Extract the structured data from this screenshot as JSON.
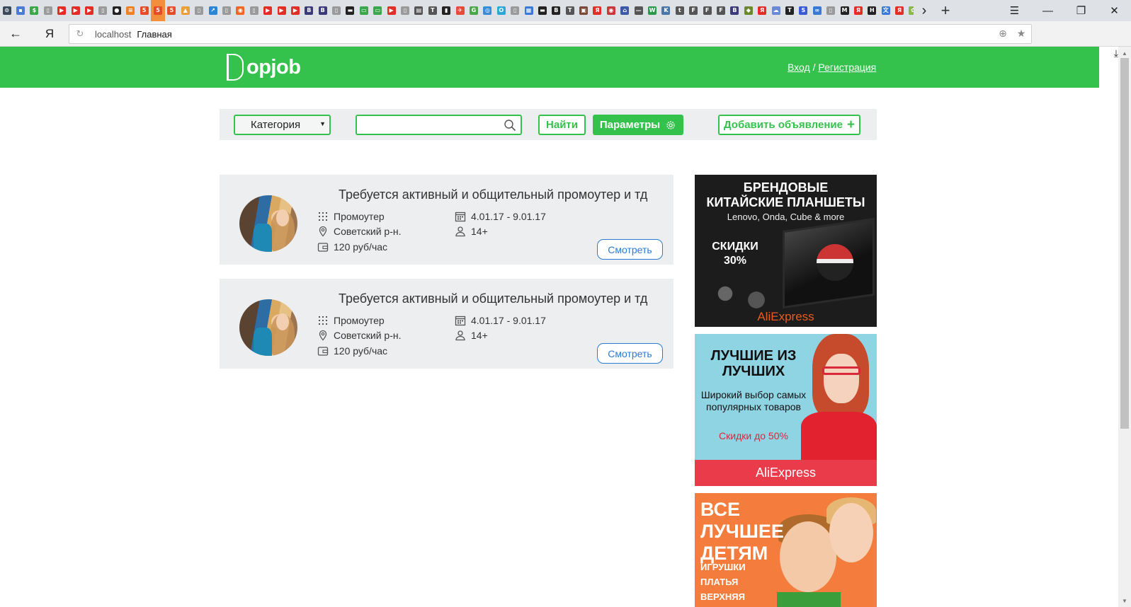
{
  "browser": {
    "tab_favicons": [
      {
        "icon": "opera-icon",
        "color": "#3b4a5a",
        "glyph": "⊙"
      },
      {
        "icon": "chart-icon",
        "color": "#4a7bd6",
        "glyph": "▪"
      },
      {
        "icon": "dollar-icon",
        "color": "#3aa84a",
        "glyph": "$"
      },
      {
        "icon": "page-icon",
        "color": "#9a9a9a",
        "glyph": "▯"
      },
      {
        "icon": "youtube-icon",
        "color": "#e52d27",
        "glyph": "▶"
      },
      {
        "icon": "youtube-icon",
        "color": "#e52d27",
        "glyph": "▶"
      },
      {
        "icon": "youtube-icon",
        "color": "#e52d27",
        "glyph": "▶"
      },
      {
        "icon": "page-icon",
        "color": "#9a9a9a",
        "glyph": "▯"
      },
      {
        "icon": "github-icon",
        "color": "#222222",
        "glyph": "●"
      },
      {
        "icon": "stackoverflow-icon",
        "color": "#f48024",
        "glyph": "≡"
      },
      {
        "icon": "html-icon",
        "color": "#e44d26",
        "glyph": "5"
      },
      {
        "icon": "html-icon",
        "color": "#e44d26",
        "glyph": "5"
      },
      {
        "icon": "html-icon",
        "color": "#e44d26",
        "glyph": "5"
      },
      {
        "icon": "image-icon",
        "color": "#e8a13a",
        "glyph": "▲"
      },
      {
        "icon": "page-icon",
        "color": "#9a9a9a",
        "glyph": "▯"
      },
      {
        "icon": "chart-icon",
        "color": "#2a85d6",
        "glyph": "↗"
      },
      {
        "icon": "page-icon",
        "color": "#9a9a9a",
        "glyph": "▯"
      },
      {
        "icon": "orange-icon",
        "color": "#f26522",
        "glyph": "◉"
      },
      {
        "icon": "page-icon",
        "color": "#9a9a9a",
        "glyph": "▯"
      },
      {
        "icon": "youtube-icon",
        "color": "#e52d27",
        "glyph": "▶"
      },
      {
        "icon": "youtube-icon",
        "color": "#e52d27",
        "glyph": "▶"
      },
      {
        "icon": "youtube-icon",
        "color": "#e52d27",
        "glyph": "▶"
      },
      {
        "icon": "b-icon",
        "color": "#3b3b7a",
        "glyph": "B"
      },
      {
        "icon": "b-icon",
        "color": "#3b3b7a",
        "glyph": "B"
      },
      {
        "icon": "page-icon",
        "color": "#9a9a9a",
        "glyph": "▯"
      },
      {
        "icon": "film-icon",
        "color": "#222222",
        "glyph": "▬"
      },
      {
        "icon": "chat-icon",
        "color": "#3aa84a",
        "glyph": "▭"
      },
      {
        "icon": "chat-icon",
        "color": "#3aa84a",
        "glyph": "▭"
      },
      {
        "icon": "youtube-icon",
        "color": "#e52d27",
        "glyph": "▶"
      },
      {
        "icon": "page-icon",
        "color": "#9a9a9a",
        "glyph": "▯"
      },
      {
        "icon": "keyboard-icon",
        "color": "#555555",
        "glyph": "▤"
      },
      {
        "icon": "t-icon",
        "color": "#555555",
        "glyph": "T"
      },
      {
        "icon": "bars-icon",
        "color": "#222222",
        "glyph": "▮"
      },
      {
        "icon": "plane-icon",
        "color": "#e84a3a",
        "glyph": "✈"
      },
      {
        "icon": "g-icon",
        "color": "#4aa84a",
        "glyph": "G"
      },
      {
        "icon": "globe-icon",
        "color": "#3a8ad6",
        "glyph": "◎"
      },
      {
        "icon": "circle-icon",
        "color": "#2aa8d6",
        "glyph": "O"
      },
      {
        "icon": "page-icon",
        "color": "#9a9a9a",
        "glyph": "▯"
      },
      {
        "icon": "windows-icon",
        "color": "#3a7ad6",
        "glyph": "▦"
      },
      {
        "icon": "film-icon",
        "color": "#222222",
        "glyph": "▬"
      },
      {
        "icon": "b-icon",
        "color": "#222222",
        "glyph": "B"
      },
      {
        "icon": "t-icon",
        "color": "#555555",
        "glyph": "T"
      },
      {
        "icon": "photo-icon",
        "color": "#7a4a3a",
        "glyph": "▣"
      },
      {
        "icon": "yandex-icon",
        "color": "#e52d27",
        "glyph": "Я"
      },
      {
        "icon": "opera-icon",
        "color": "#c43a3a",
        "glyph": "◉"
      },
      {
        "icon": "bank-icon",
        "color": "#3a5aa8",
        "glyph": "⌂"
      },
      {
        "icon": "line-icon",
        "color": "#555555",
        "glyph": "—"
      },
      {
        "icon": "w-icon",
        "color": "#2a9a4a",
        "glyph": "W"
      },
      {
        "icon": "vk-icon",
        "color": "#4a76a8",
        "glyph": "K"
      },
      {
        "icon": "t-icon",
        "color": "#555555",
        "glyph": "t"
      },
      {
        "icon": "f-icon",
        "color": "#555555",
        "glyph": "F"
      },
      {
        "icon": "f-icon",
        "color": "#555555",
        "glyph": "F"
      },
      {
        "icon": "f-icon",
        "color": "#555555",
        "glyph": "F"
      },
      {
        "icon": "b-icon",
        "color": "#3b3b7a",
        "glyph": "B"
      },
      {
        "icon": "layers-icon",
        "color": "#6a8a2a",
        "glyph": "◆"
      },
      {
        "icon": "yandex-icon",
        "color": "#e52d27",
        "glyph": "Я"
      },
      {
        "icon": "cloud-icon",
        "color": "#6a8ad6",
        "glyph": "☁"
      },
      {
        "icon": "t-icon",
        "color": "#222222",
        "glyph": "T"
      },
      {
        "icon": "s-icon",
        "color": "#3a5ad6",
        "glyph": "S"
      },
      {
        "icon": "link-icon",
        "color": "#3a7ad6",
        "glyph": "∞"
      },
      {
        "icon": "page-icon",
        "color": "#9a9a9a",
        "glyph": "▯"
      },
      {
        "icon": "m-icon",
        "color": "#222222",
        "glyph": "M"
      },
      {
        "icon": "yandex-icon",
        "color": "#e52d27",
        "glyph": "Я"
      },
      {
        "icon": "h-icon",
        "color": "#222222",
        "glyph": "H"
      },
      {
        "icon": "translate-icon",
        "color": "#3a7ad6",
        "glyph": "文"
      },
      {
        "icon": "yandex-icon",
        "color": "#e52d27",
        "glyph": "Я"
      },
      {
        "icon": "leaf-icon",
        "color": "#8ab84a",
        "glyph": "✿"
      }
    ],
    "active_tab_index": 11,
    "address": {
      "host": "localhost",
      "title": "Главная"
    }
  },
  "site": {
    "brand_color": "#35c24c",
    "logo_text": "opjob",
    "auth": {
      "login": "Вход",
      "separator": "/",
      "register": "Регистрация"
    }
  },
  "search": {
    "category_label": "Категория",
    "query": "",
    "find_label": "Найти",
    "params_label": "Параметры",
    "add_label": "Добавить объявление"
  },
  "listings": [
    {
      "title": "Требуется активный и общительный промоутер и тд",
      "category": "Промоутер",
      "district": "Советский р-н.",
      "pay": "120 руб/час",
      "dates": "4.01.17 - 9.01.17",
      "age": "14+",
      "view_label": "Смотреть"
    },
    {
      "title": "Требуется активный и общительный промоутер и тд",
      "category": "Промоутер",
      "district": "Советский р-н.",
      "pay": "120 руб/час",
      "dates": "4.01.17 - 9.01.17",
      "age": "14+",
      "view_label": "Смотреть"
    }
  ],
  "ads": {
    "tablets": {
      "headline": "БРЕНДОВЫЕ КИТАЙСКИЕ ПЛАНШЕТЫ",
      "brands": "Lenovo, Onda, Cube & more",
      "discount": "СКИДКИ 30%",
      "store": "AliExpress"
    },
    "best": {
      "headline": "ЛУЧШИЕ ИЗ ЛУЧШИХ",
      "text": "Широкий выбор самых популярных товаров",
      "discount": "Скидки до 50%",
      "store": "AliExpress"
    },
    "kids": {
      "headline": "ВСЕ ЛУЧШЕЕ ДЕТЯМ",
      "items": "ИГРУШКИ ПЛАТЬЯ ВЕРХНЯЯ"
    }
  }
}
